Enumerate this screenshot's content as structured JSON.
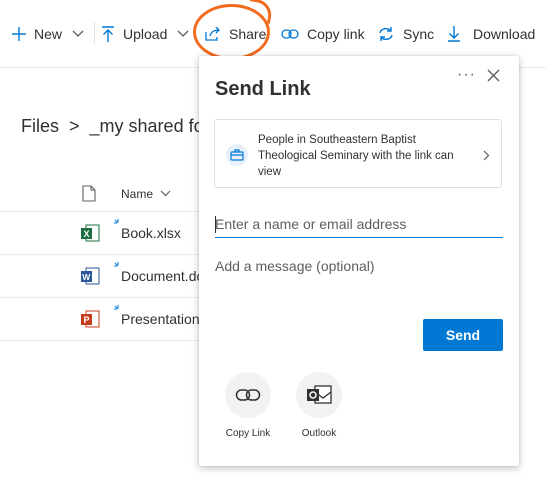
{
  "toolbar": {
    "new_label": "New",
    "upload_label": "Upload",
    "share_label": "Share",
    "copy_link_label": "Copy link",
    "sync_label": "Sync",
    "download_label": "Download"
  },
  "breadcrumb": {
    "root": "Files",
    "separator": ">",
    "current": "_my shared fo"
  },
  "files": {
    "column_name": "Name",
    "rows": [
      {
        "name": "Book.xlsx",
        "type": "excel"
      },
      {
        "name": "Document.do",
        "type": "word"
      },
      {
        "name": "Presentation",
        "type": "powerpoint"
      }
    ]
  },
  "share_panel": {
    "title": "Send Link",
    "more_label": "···",
    "permission_text": "People in Southeastern Baptist Theological Seminary with the link can view",
    "name_placeholder": "Enter a name or email address",
    "message_placeholder": "Add a message (optional)",
    "send_label": "Send",
    "options": [
      {
        "label": "Copy Link",
        "icon": "copy-link-icon"
      },
      {
        "label": "Outlook",
        "icon": "outlook-icon"
      }
    ]
  },
  "colors": {
    "accent": "#0078d4",
    "annotation": "#f26b1f",
    "excel": "#1d6f42",
    "word": "#2b579a",
    "powerpoint": "#c43e1c"
  }
}
